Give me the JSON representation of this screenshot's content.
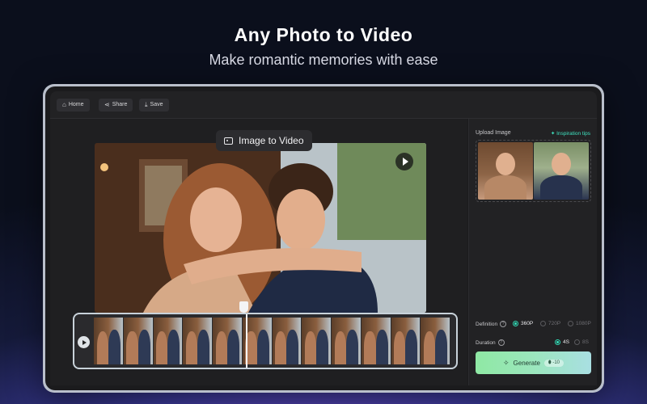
{
  "headline": "Any Photo to Video",
  "subhead": "Make romantic memories with ease",
  "toolbar": {
    "home_label": "Home",
    "share_label": "Share",
    "save_label": "Save"
  },
  "editor": {
    "mode_chip_label": "Image to Video"
  },
  "panel": {
    "upload_label": "Upload Image",
    "tips_label": "Inspiration tips",
    "definition": {
      "label": "Definition",
      "options": [
        "360P",
        "720P",
        "1080P"
      ],
      "selected": "360P"
    },
    "duration": {
      "label": "Duration",
      "options": [
        "4S",
        "8S"
      ],
      "selected": "4S"
    },
    "generate": {
      "label": "Generate",
      "cost": "-10"
    }
  },
  "icons": {
    "home": "home-icon",
    "share": "share-icon",
    "save": "download-icon",
    "mode": "image-icon",
    "play": "play-icon",
    "help": "help-icon",
    "sparkle": "sparkle-icon",
    "wand": "magic-wand-icon"
  },
  "colors": {
    "accent": "#32d6b2",
    "generate_gradient_start": "#8fe8a4",
    "generate_gradient_end": "#a9dfe2"
  }
}
